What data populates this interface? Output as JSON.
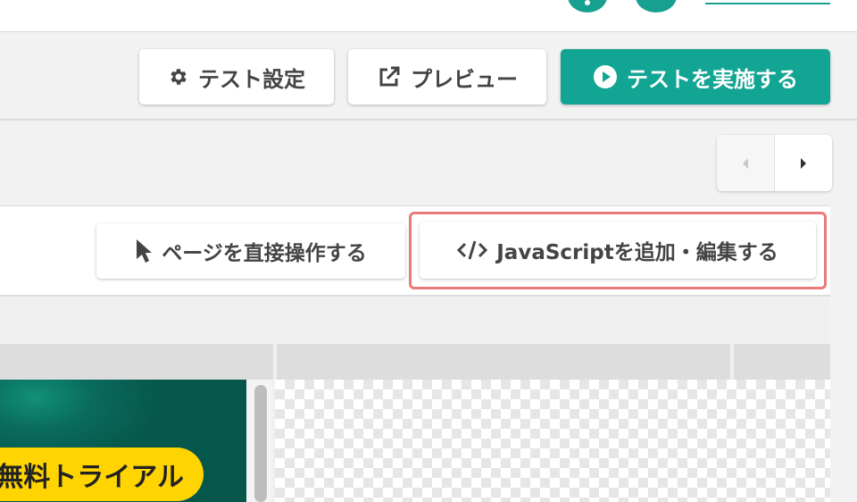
{
  "header": {
    "help_icon": "help-circle-icon",
    "settings_icon": "gear-icon"
  },
  "toolbar": {
    "test_settings_label": "テスト設定",
    "test_settings_icon": "gear-icon",
    "preview_label": "プレビュー",
    "preview_icon": "external-link-icon",
    "run_test_label": "テストを実施する",
    "run_test_icon": "play-circle-icon"
  },
  "pager": {
    "prev_icon": "caret-left-icon",
    "next_icon": "caret-right-icon"
  },
  "editor": {
    "direct_edit_label": "ページを直接操作する",
    "direct_edit_icon": "cursor-arrow-icon",
    "js_edit_label": "JavaScriptを追加・編集する",
    "js_edit_icon": "code-icon"
  },
  "preview": {
    "banner_text": "無料トライアル"
  },
  "colors": {
    "accent": "#13a593",
    "highlight": "#e87a7a",
    "banner_pill": "#ffd400"
  }
}
